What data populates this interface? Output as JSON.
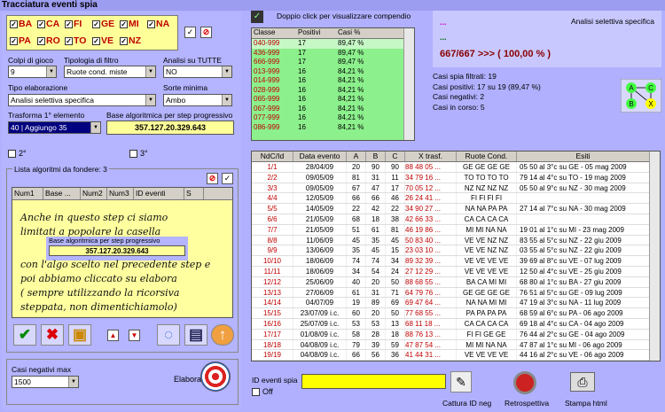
{
  "title": "Tracciatura eventi spia",
  "wheels": [
    {
      "n": "BA",
      "checked": true
    },
    {
      "n": "CA",
      "checked": true
    },
    {
      "n": "FI",
      "checked": true
    },
    {
      "n": "GE",
      "checked": true
    },
    {
      "n": "MI",
      "checked": true
    },
    {
      "n": "NA",
      "checked": true
    },
    {
      "n": "PA",
      "checked": true
    },
    {
      "n": "RO",
      "checked": true
    },
    {
      "n": "TO",
      "checked": true
    },
    {
      "n": "VE",
      "checked": true
    },
    {
      "n": "NZ",
      "checked": true
    }
  ],
  "form": {
    "colpi_label": "Colpi di gioco",
    "colpi_value": "9",
    "tipologia_label": "Tipologia di filtro",
    "tipologia_value": "Ruote cond. miste",
    "analisi_label": "Analisi su TUTTE",
    "analisi_value": "NO",
    "tipo_label": "Tipo elaborazione",
    "tipo_value": "Analisi selettiva specifica",
    "sorte_label": "Sorte minima",
    "sorte_value": "Ambo",
    "trasforma_label": "Trasforma 1° elemento",
    "trasforma_value": "40 | Aggiungo 35",
    "base_label": "Base algoritmica per step progressivo",
    "base_value": "357.127.20.329.643",
    "opt2": "2°",
    "opt3": "3°"
  },
  "lista": {
    "title": "Lista algoritmi da fondere: 3",
    "headers": [
      "Num1",
      "Base ...",
      "Num2",
      "Num3",
      "ID eventi",
      "S"
    ],
    "note1": "Anche in questo step ci siamo",
    "note2": "limitati a popolare la casella",
    "popup_label": "Base algoritmica per step progressivo",
    "popup_value": "357.127.20.329.643",
    "note3": "con l'algo scelto nel precedente step e",
    "note4": "poi abbiamo cliccato su elabora",
    "note5": "( sempre utilizzando la ricorsiva",
    "note6": "steppata, non dimentichiamolo)"
  },
  "casi_neg_label": "Casi negativi max",
  "casi_neg_value": "1500",
  "elabora": "Elabora",
  "compendio_text": "Doppio click per visualizzare compendio",
  "compendio": {
    "headers": [
      "Classe",
      "Positivi",
      "Casi %"
    ],
    "rows": [
      [
        "040-999",
        "17",
        "89,47 %"
      ],
      [
        "436-999",
        "17",
        "89,47 %"
      ],
      [
        "666-999",
        "17",
        "89,47 %"
      ],
      [
        "013-999",
        "16",
        "84,21 %"
      ],
      [
        "014-999",
        "16",
        "84,21 %"
      ],
      [
        "028-999",
        "16",
        "84,21 %"
      ],
      [
        "065-999",
        "16",
        "84,21 %"
      ],
      [
        "067-999",
        "16",
        "84,21 %"
      ],
      [
        "077-999",
        "16",
        "84,21 %"
      ],
      [
        "086-999",
        "16",
        "84,21 %"
      ]
    ]
  },
  "info": {
    "dots1": "...",
    "dots2": "...",
    "result": "667/667 >>> ( 100,00 % )",
    "mode": "Analisi selettiva specifica",
    "line1": "Casi spia filtrati: 19",
    "line2": "Casi positivi: 17 su 19 (89,47 %)",
    "line3": "Casi negativi: 2",
    "line4": "Casi in corso: 5"
  },
  "diagram": {
    "a": "A",
    "b": "B",
    "c": "C",
    "x": "X"
  },
  "table": {
    "headers": [
      "NdC/Id",
      "Data evento",
      "A",
      "B",
      "C",
      "X trasf.",
      "Ruote Cond.",
      "Esiti"
    ],
    "rows": [
      [
        "1/1",
        "28/04/09",
        "20",
        "90",
        "90",
        "88 48 05 ...",
        "GE GE GE GE",
        "05 50 al 3°c su GE - 05 mag 2009"
      ],
      [
        "2/2",
        "09/05/09",
        "81",
        "31",
        "11",
        "34 79 16 ...",
        "TO TO TO TO",
        "79 14 al 4°c su TO - 19 mag 2009"
      ],
      [
        "3/3",
        "09/05/09",
        "67",
        "47",
        "17",
        "70 05 12 ...",
        "NZ NZ NZ NZ",
        "05 50 al 9°c su NZ - 30 mag 2009"
      ],
      [
        "4/4",
        "12/05/09",
        "66",
        "66",
        "46",
        "26 24 41 ...",
        "FI FI FI FI",
        ""
      ],
      [
        "5/5",
        "14/05/09",
        "22",
        "42",
        "22",
        "34 90 27 ...",
        "NA NA PA PA",
        "27 14 al 7°c su NA - 30 mag 2009"
      ],
      [
        "6/6",
        "21/05/09",
        "68",
        "18",
        "38",
        "42 66 33 ...",
        "CA CA CA CA",
        ""
      ],
      [
        "7/7",
        "21/05/09",
        "51",
        "61",
        "81",
        "46 19 86 ...",
        "MI MI NA NA",
        "19 01 al 1°c su MI - 23 mag 2009"
      ],
      [
        "8/8",
        "11/06/09",
        "45",
        "35",
        "45",
        "50 83 40 ...",
        "VE VE NZ NZ",
        "83 55 al 5°c su NZ - 22 giu 2009"
      ],
      [
        "9/9",
        "13/06/09",
        "35",
        "45",
        "15",
        "23 03 10 ...",
        "VE VE NZ NZ",
        "03 55 al 5°c su NZ - 22 giu 2009"
      ],
      [
        "10/10",
        "18/06/09",
        "74",
        "74",
        "34",
        "89 32 39 ...",
        "VE VE VE VE",
        "39 69 al 8°c su VE - 07 lug 2009"
      ],
      [
        "11/11",
        "18/06/09",
        "34",
        "54",
        "24",
        "27 12 29 ...",
        "VE VE VE VE",
        "12 50 al 4°c su VE - 25 giu 2009"
      ],
      [
        "12/12",
        "25/06/09",
        "40",
        "20",
        "50",
        "88 68 55 ...",
        "BA CA MI MI",
        "68 80 al 1°c su BA - 27 giu 2009"
      ],
      [
        "13/13",
        "27/06/09",
        "61",
        "31",
        "71",
        "64 79 76 ...",
        "GE GE GE GE",
        "76 51 al 5°c su GE - 09 lug 2009"
      ],
      [
        "14/14",
        "04/07/09",
        "19",
        "89",
        "69",
        "69 47 64 ...",
        "NA NA MI MI",
        "47 19 al 3°c su NA - 11 lug 2009"
      ],
      [
        "15/15",
        "23/07/09 i.c.",
        "60",
        "20",
        "50",
        "77 68 55 ...",
        "PA PA PA PA",
        "68 59 al 6°c su PA - 06 ago 2009"
      ],
      [
        "16/16",
        "25/07/09 i.c.",
        "53",
        "53",
        "13",
        "68 11 18 ...",
        "CA CA CA CA",
        "69 18 al 4°c su CA - 04 ago 2009"
      ],
      [
        "17/17",
        "01/08/09 i.c.",
        "58",
        "28",
        "18",
        "88 76 13 ...",
        "FI FI GE GE",
        "76 44 al 2°c su GE - 04 ago 2009"
      ],
      [
        "18/18",
        "04/08/09 i.c.",
        "79",
        "39",
        "59",
        "47 87 54 ...",
        "MI MI NA NA",
        "47 87 al 1°c su MI - 06 ago 2009"
      ],
      [
        "19/19",
        "04/08/09 i.c.",
        "66",
        "56",
        "36",
        "41 44 31 ...",
        "VE VE VE VE",
        "44 16 al 2°c su VE - 06 ago 2009"
      ]
    ]
  },
  "bottom": {
    "id_label": "ID eventi spia",
    "off_label": "Off",
    "cattura": "Cattura ID neg",
    "retro": "Retrospettiva",
    "stampa": "Stampa html"
  }
}
